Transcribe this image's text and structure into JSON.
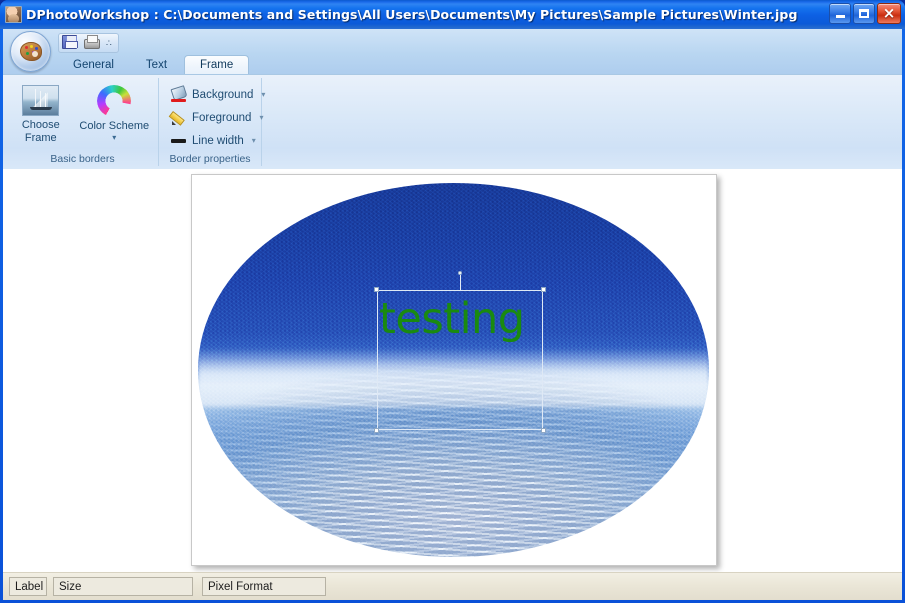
{
  "window": {
    "title": "DPhotoWorkshop : C:\\Documents and Settings\\All Users\\Documents\\My Pictures\\Sample Pictures\\Winter.jpg",
    "app_icon": "photo-thumbnail-icon",
    "minimize_label": "",
    "maximize_label": "",
    "close_label": "×"
  },
  "ribbon": {
    "app_button_name": "palette-app-button",
    "quick_access": [
      {
        "name": "save-button",
        "icon": "floppy-disk-icon"
      },
      {
        "name": "print-button",
        "icon": "printer-icon"
      }
    ],
    "quick_access_more": "∴",
    "tabs": [
      {
        "label": "General",
        "active": false
      },
      {
        "label": "Text",
        "active": false
      },
      {
        "label": "Frame",
        "active": true
      }
    ],
    "groups": [
      {
        "label": "Basic borders",
        "items": [
          {
            "label_line1": "Choose",
            "label_line2": "Frame",
            "icon": "sailboat-thumbnail-icon",
            "has_dropdown": false
          },
          {
            "label_line1": "Color Scheme",
            "label_line2": "",
            "icon": "color-wheel-icon",
            "has_dropdown": true,
            "dropdown_glyph": "▾"
          }
        ]
      },
      {
        "label": "Border properties",
        "items": [
          {
            "label": "Background",
            "icon": "paint-bucket-icon",
            "dropdown_glyph": "▾"
          },
          {
            "label": "Foreground",
            "icon": "pencil-icon",
            "dropdown_glyph": "▾"
          },
          {
            "label": "Line width",
            "icon": "line-width-icon",
            "dropdown_glyph": "▾"
          }
        ]
      }
    ]
  },
  "canvas": {
    "image_name": "Winter.jpg",
    "frame_shape": "ellipse",
    "text_object": {
      "value": "testing",
      "color": "#1a8a10",
      "selected": true
    }
  },
  "statusbar": {
    "panels": [
      {
        "name": "status-label",
        "text": "Label"
      },
      {
        "name": "status-size",
        "text": "Size"
      },
      {
        "name": "status-pixel-format",
        "text": "Pixel Format"
      }
    ]
  },
  "colors": {
    "titlebar_blue": "#0a58d8",
    "close_red": "#c82e10",
    "ribbon_blue": "#cfe1f6",
    "text_green": "#1a8a10",
    "status_bg": "#eae6d7"
  }
}
